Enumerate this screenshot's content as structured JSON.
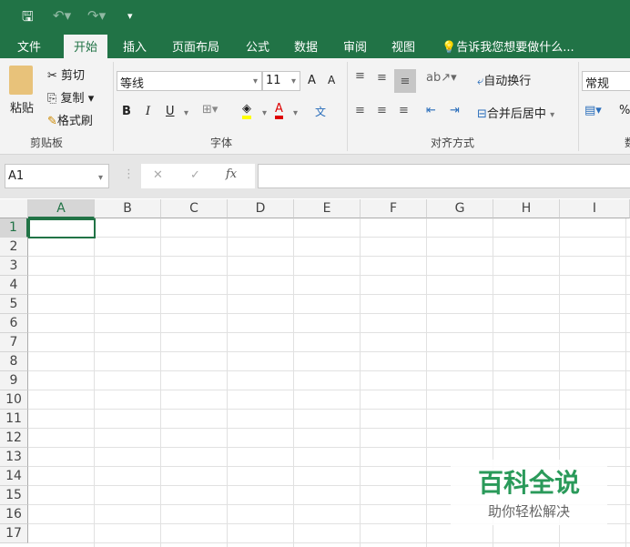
{
  "quick_access": {
    "save": "save-icon",
    "undo": "undo-icon",
    "redo": "redo-icon",
    "customize": "▾"
  },
  "tabs": [
    "文件",
    "开始",
    "插入",
    "页面布局",
    "公式",
    "数据",
    "审阅",
    "视图"
  ],
  "tell_me": "告诉我您想要做什么...",
  "clipboard": {
    "paste": "粘贴",
    "cut": "剪切",
    "copy": "复制",
    "format_painter": "格式刷",
    "group": "剪贴板"
  },
  "font": {
    "name": "等线",
    "size": "11",
    "bold": "B",
    "italic": "I",
    "underline": "U",
    "grow": "A",
    "shrink": "A",
    "color": "A",
    "phonetic": "文",
    "group": "字体"
  },
  "alignment": {
    "wrap": "自动换行",
    "merge": "合并后居中",
    "group": "对齐方式"
  },
  "number": {
    "format": "常规",
    "percent": "%",
    "group": "数"
  },
  "formula_bar": {
    "name_box": "A1",
    "cancel": "✕",
    "enter": "✓",
    "fx": "fx",
    "value": ""
  },
  "columns": [
    "A",
    "B",
    "C",
    "D",
    "E",
    "F",
    "G",
    "H",
    "I"
  ],
  "rows": [
    "1",
    "2",
    "3",
    "4",
    "5",
    "6",
    "7",
    "8",
    "9",
    "10",
    "11",
    "12",
    "13",
    "14",
    "15",
    "16",
    "17"
  ],
  "watermark": {
    "title": "百科全说",
    "subtitle": "助你轻松解决"
  },
  "colors": {
    "accent": "#217346"
  }
}
